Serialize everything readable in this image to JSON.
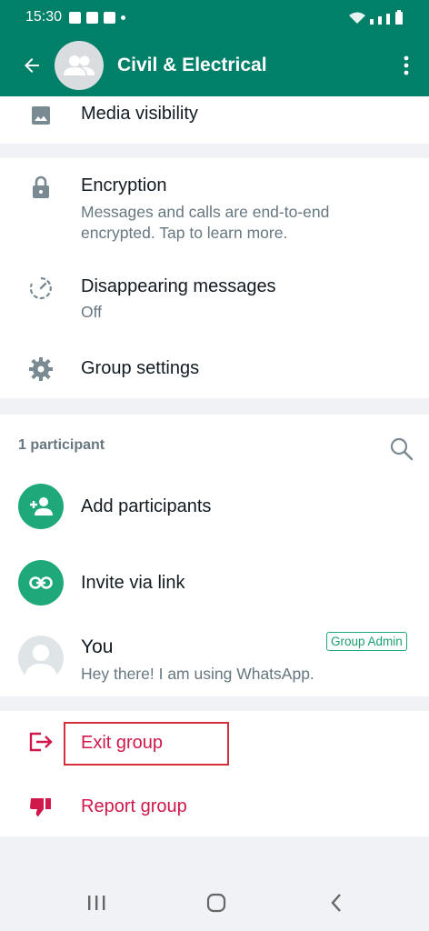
{
  "status_bar": {
    "time": "15:30"
  },
  "app_bar": {
    "title": "Civil & Electrical"
  },
  "media": {
    "label": "Media visibility"
  },
  "privacy": {
    "encryption_label": "Encryption",
    "encryption_sub": "Messages and calls are end-to-end encrypted. Tap to learn more.",
    "disappearing_label": "Disappearing messages",
    "disappearing_sub": "Off",
    "group_settings_label": "Group settings"
  },
  "participants": {
    "count_label": "1 participant",
    "add_label": "Add participants",
    "invite_label": "Invite via link",
    "member": {
      "name": "You",
      "status": "Hey there! I am using WhatsApp.",
      "badge": "Group Admin"
    }
  },
  "actions": {
    "exit_label": "Exit group",
    "report_label": "Report group"
  },
  "colors": {
    "header": "#008069",
    "accent_green": "#1fa97a",
    "danger": "#d0184a"
  },
  "icons": [
    "arrow-back-icon",
    "group-avatar-icon",
    "more-vert-icon",
    "image-icon",
    "lock-icon",
    "timer-icon",
    "gear-icon",
    "search-icon",
    "add-person-icon",
    "link-icon",
    "person-avatar-icon",
    "exit-icon",
    "thumb-down-icon"
  ]
}
